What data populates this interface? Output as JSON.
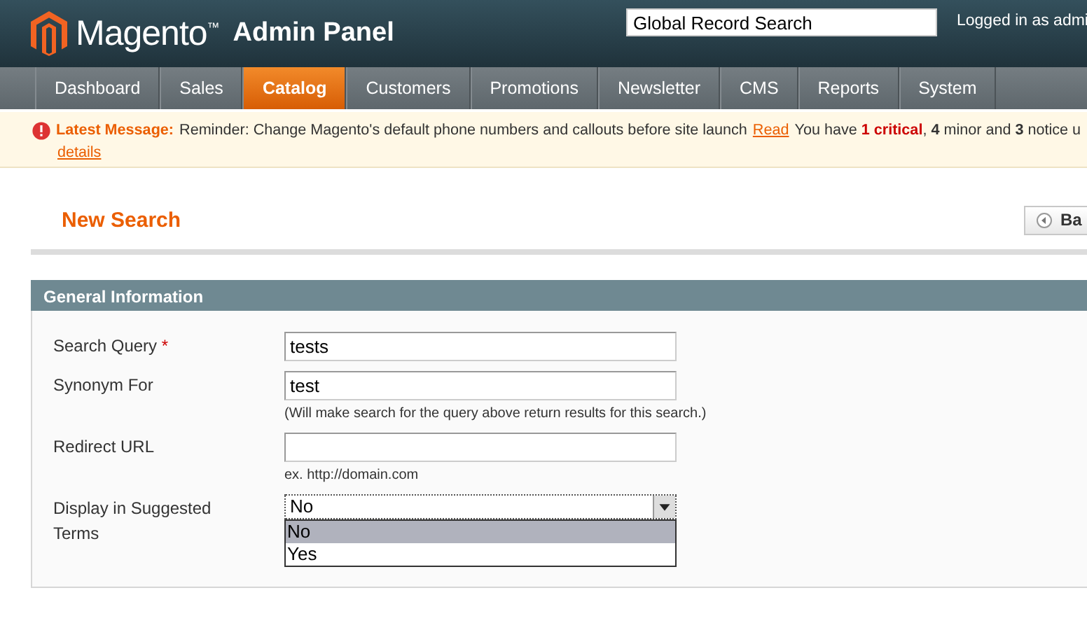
{
  "header": {
    "logo_text": "Magento",
    "logo_mark": "™",
    "subtitle": "Admin Panel",
    "search": {
      "value": "Global Record Search"
    },
    "user_text": "Logged in as admi"
  },
  "nav": [
    {
      "label": "Dashboard",
      "selected": false
    },
    {
      "label": "Sales",
      "selected": false
    },
    {
      "label": "Catalog",
      "selected": true
    },
    {
      "label": "Customers",
      "selected": false
    },
    {
      "label": "Promotions",
      "selected": false
    },
    {
      "label": "Newsletter",
      "selected": false
    },
    {
      "label": "CMS",
      "selected": false
    },
    {
      "label": "Reports",
      "selected": false
    },
    {
      "label": "System",
      "selected": false
    }
  ],
  "message": {
    "label": "Latest Message:",
    "text": "Reminder: Change Magento's default phone numbers and callouts before site launch",
    "read_link": "Read",
    "summary": "You have **1 critical**, **4** minor and **3** notice u",
    "details_link": "details"
  },
  "page": {
    "title": "New Search",
    "back_button": "Ba"
  },
  "section": {
    "title": "General Information",
    "fields": [
      {
        "kind": "text",
        "label": "Search Query",
        "required_mark": "*",
        "value": "tests"
      },
      {
        "kind": "text",
        "label": "Synonym For",
        "value": "test",
        "note": "(Will make search for the query above return results for this search.)"
      },
      {
        "kind": "text",
        "label": "Redirect URL",
        "note": "ex. http://domain.com"
      },
      {
        "kind": "select",
        "label": "Display in Suggested Terms",
        "value": "No",
        "expanded": true,
        "options": [
          {
            "label": "No",
            "selected": true
          },
          {
            "label": "Yes",
            "selected": false
          }
        ]
      }
    ]
  }
}
